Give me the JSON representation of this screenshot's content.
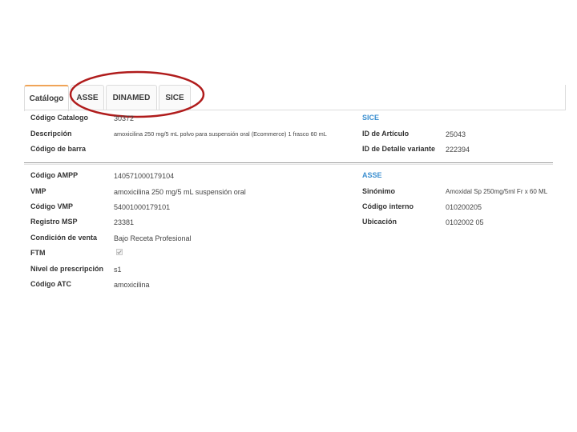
{
  "tabs": [
    {
      "label": "Catálogo"
    },
    {
      "label": "ASSE"
    },
    {
      "label": "DINAMED"
    },
    {
      "label": "SICE"
    }
  ],
  "left_top": {
    "codigo_catalogo": {
      "label": "Código Catalogo",
      "value": "30372"
    },
    "descripcion": {
      "label": "Descripción",
      "value": "amoxicilina 250 mg/5 mL polvo para suspensión oral (Ecommerce) 1 frasco 60 mL"
    },
    "codigo_barra": {
      "label": "Código de barra",
      "value": ""
    }
  },
  "sice": {
    "title": "SICE",
    "id_articulo": {
      "label": "ID de Artículo",
      "value": "25043"
    },
    "id_detalle": {
      "label": "ID de Detalle variante",
      "value": "222394"
    }
  },
  "left_bottom": {
    "codigo_ampp": {
      "label": "Código AMPP",
      "value": "140571000179104"
    },
    "vmp": {
      "label": "VMP",
      "value": "amoxicilina 250 mg/5 mL suspensión oral"
    },
    "codigo_vmp": {
      "label": "Código VMP",
      "value": "54001000179101"
    },
    "registro_msp": {
      "label": "Registro MSP",
      "value": "23381"
    },
    "condicion_venta": {
      "label": "Condición de venta",
      "value": "Bajo Receta Profesional"
    },
    "ftm": {
      "label": "FTM",
      "checked": true
    },
    "nivel_prescripcion": {
      "label": "Nivel de prescripción",
      "value": "s1"
    },
    "codigo_atc": {
      "label": "Código ATC",
      "value": "amoxicilina"
    }
  },
  "asse": {
    "title": "ASSE",
    "sinonimo": {
      "label": "Sinónimo",
      "value": "Amoxidal Sp 250mg/5ml Fr x 60 ML"
    },
    "codigo_interno": {
      "label": "Código interno",
      "value": "010200205"
    },
    "ubicacion": {
      "label": "Ubicación",
      "value": "0102002 05"
    }
  },
  "colors": {
    "accent": "#f0a458",
    "section": "#3b8fd0",
    "oval": "#b01c1c"
  }
}
